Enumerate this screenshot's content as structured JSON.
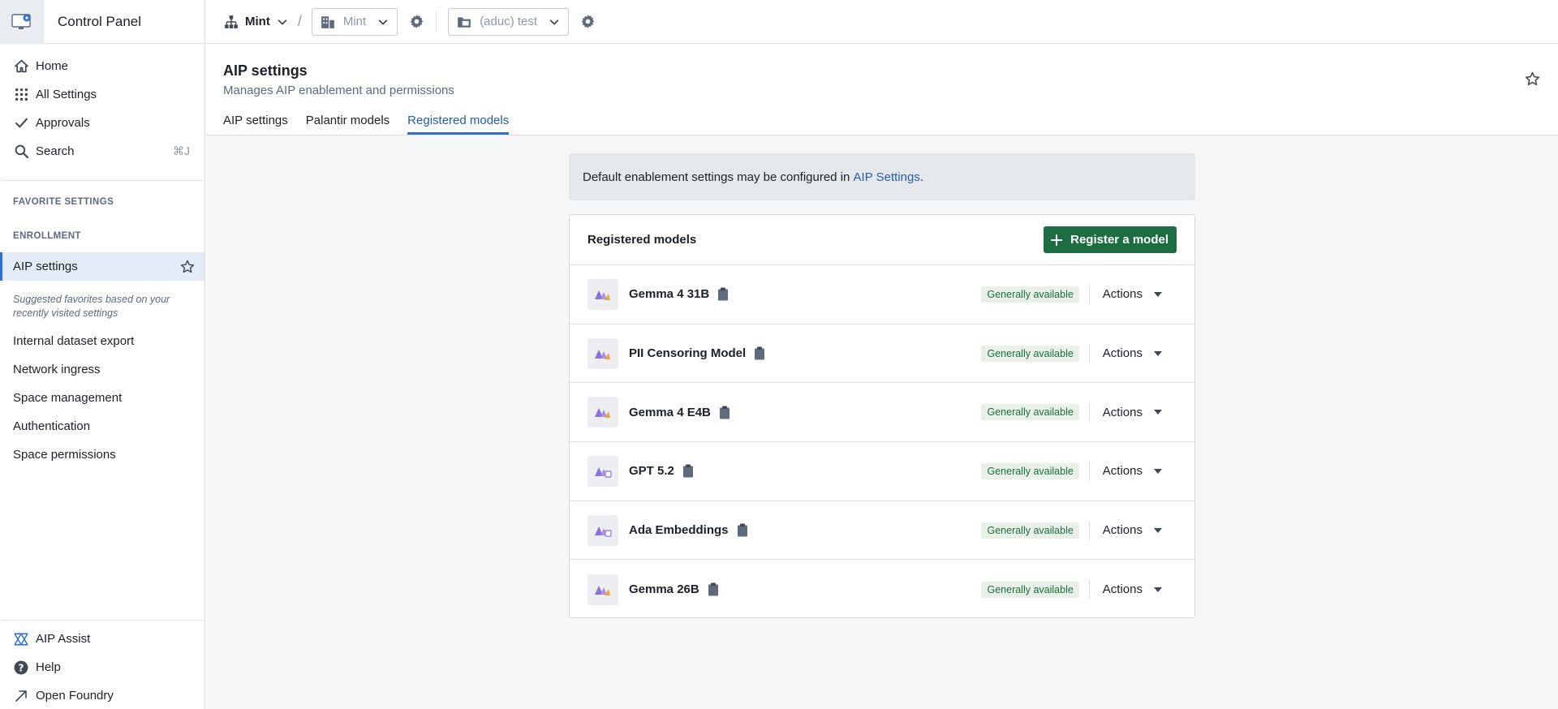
{
  "app": {
    "title": "Control Panel"
  },
  "nav": {
    "items": [
      {
        "label": "Home",
        "icon": "home-icon"
      },
      {
        "label": "All Settings",
        "icon": "grid-icon"
      },
      {
        "label": "Approvals",
        "icon": "check-icon"
      },
      {
        "label": "Search",
        "icon": "search-icon",
        "shortcut": "⌘J"
      }
    ]
  },
  "sidebar": {
    "favorites_label": "FAVORITE SETTINGS",
    "enrollment_label": "ENROLLMENT",
    "active_item": "AIP settings",
    "suggested_note": "Suggested favorites based on your recently visited settings",
    "suggested": [
      "Internal dataset export",
      "Network ingress",
      "Space management",
      "Authentication",
      "Space permissions"
    ],
    "bottom": [
      {
        "label": "AIP Assist",
        "icon": "aip-assist-icon"
      },
      {
        "label": "Help",
        "icon": "help-icon"
      },
      {
        "label": "Open Foundry",
        "icon": "arrow-up-right-icon"
      }
    ]
  },
  "topbar": {
    "org": "Mint",
    "enrollment_select": "Mint",
    "space_select": "(aduc) test"
  },
  "page": {
    "title": "AIP settings",
    "subtitle": "Manages AIP enablement and permissions",
    "tabs": [
      "AIP settings",
      "Palantir models",
      "Registered models"
    ],
    "active_tab": "Registered models"
  },
  "callout": {
    "text_before": "Default enablement settings may be configured in ",
    "link": "AIP Settings",
    "text_after": "."
  },
  "registered": {
    "title": "Registered models",
    "register_button": "Register a model",
    "status_label": "Generally available",
    "actions_label": "Actions",
    "models": [
      {
        "name": "Gemma 4 31B",
        "status": "Generally available"
      },
      {
        "name": "PII Censoring Model",
        "status": "Generally available"
      },
      {
        "name": "Gemma 4 E4B",
        "status": "Generally available"
      },
      {
        "name": "GPT 5.2",
        "status": "Generally available"
      },
      {
        "name": "Ada Embeddings",
        "status": "Generally available"
      },
      {
        "name": "Gemma 26B",
        "status": "Generally available"
      }
    ]
  },
  "colors": {
    "accent": "#2d72d2",
    "primary_button": "#1c6e42",
    "badge_bg": "#e8f0e8",
    "badge_text": "#1c6e42"
  }
}
